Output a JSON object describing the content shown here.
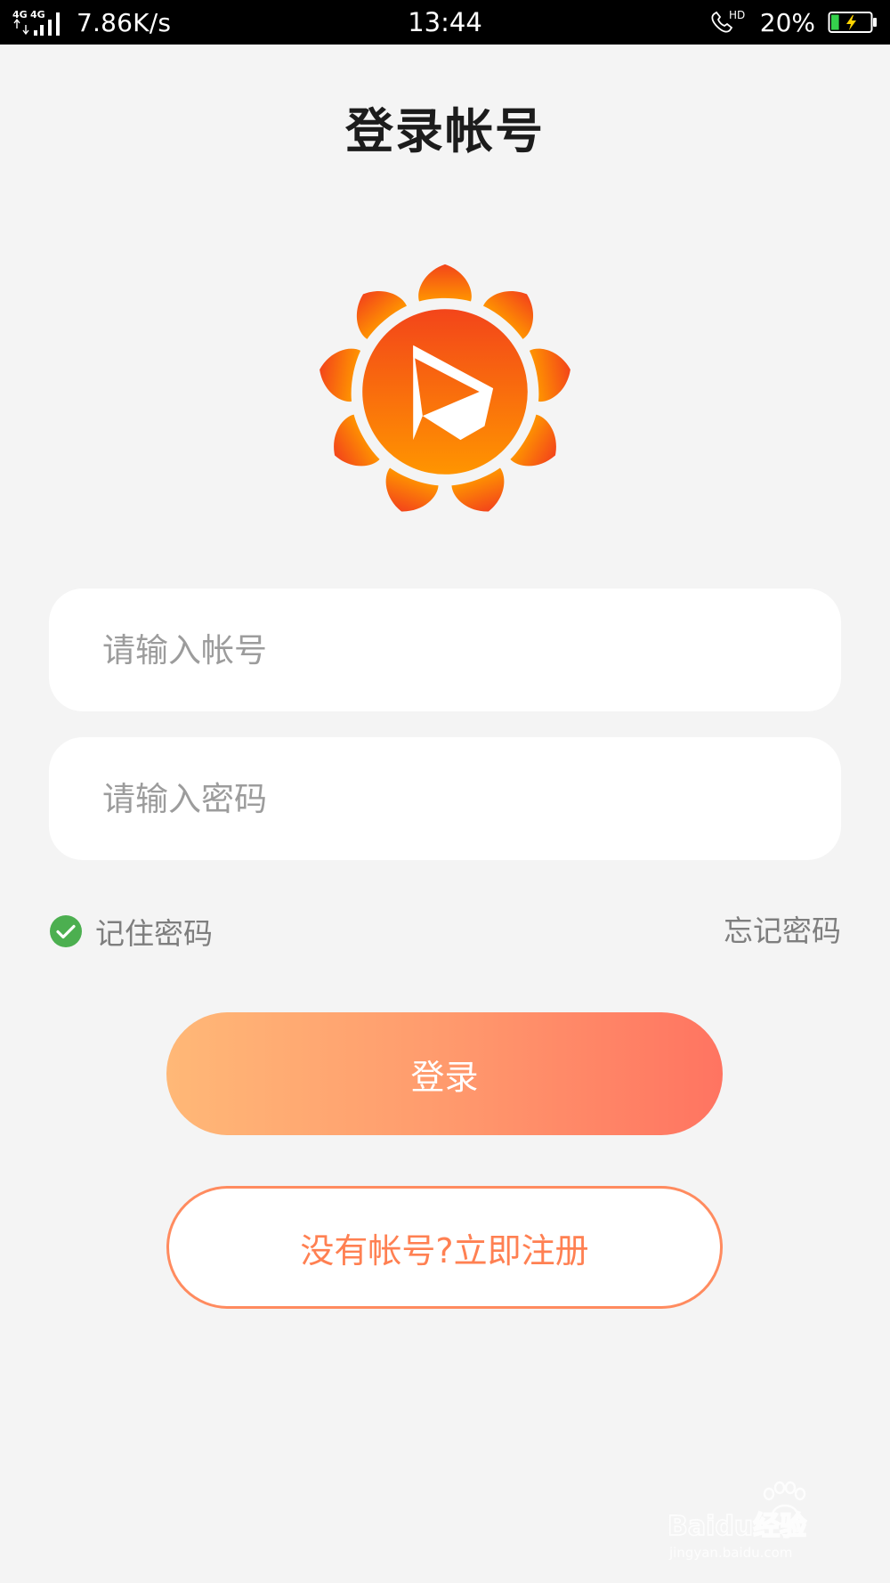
{
  "status_bar": {
    "network_type": "4G 4G",
    "speed": "7.86K/s",
    "time": "13:44",
    "call_hd": "HD",
    "battery_percent": "20%",
    "battery_level": 0.2,
    "battery_charging": true
  },
  "header": {
    "title": "登录帐号"
  },
  "logo": {
    "icon": "sunflower-play-logo",
    "colors": {
      "top": "#f3451a",
      "bottom": "#ff9500"
    }
  },
  "form": {
    "account_placeholder": "请输入帐号",
    "account_value": "",
    "password_placeholder": "请输入密码",
    "password_value": "",
    "remember_label": "记住密码",
    "remember_checked": true,
    "forgot_label": "忘记密码"
  },
  "actions": {
    "login_label": "登录",
    "register_label": "没有帐号?立即注册"
  },
  "colors": {
    "background": "#f4f4f4",
    "accent": "#ff8052",
    "check_green": "#4caf50"
  },
  "watermark": {
    "brand": "Baidu经验",
    "url": "jingyan.baidu.com"
  }
}
